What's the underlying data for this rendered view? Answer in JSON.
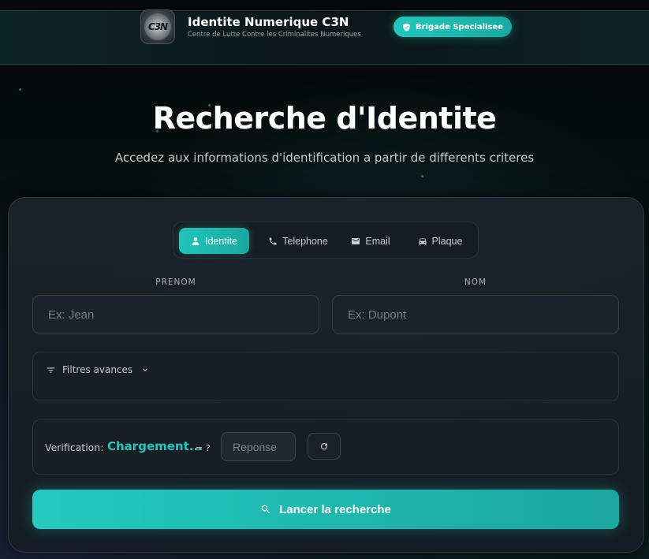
{
  "header": {
    "logo_text": "C3N",
    "title": "Identite Numerique C3N",
    "subtitle": "Centre de Lutte Contre les Criminalites Numeriques",
    "badge": "Brigade Specialisee"
  },
  "hero": {
    "title": "Recherche d'Identite",
    "subtitle": "Accedez aux informations d'identification a partir de differents criteres"
  },
  "tabs": [
    {
      "label": "Identite",
      "icon": "person-icon",
      "active": true
    },
    {
      "label": "Telephone",
      "icon": "phone-icon",
      "active": false
    },
    {
      "label": "Email",
      "icon": "email-icon",
      "active": false
    },
    {
      "label": "Plaque",
      "icon": "car-icon",
      "active": false
    }
  ],
  "form": {
    "prenom_label": "PRENOM",
    "prenom_placeholder": "Ex: Jean",
    "nom_label": "NOM",
    "nom_placeholder": "Ex: Dupont",
    "filters_label": "Filtres avances"
  },
  "verification": {
    "label": "Verification:",
    "value": "Chargement...",
    "equals": "= ?",
    "input_placeholder": "Reponse"
  },
  "submit_label": "Lancer la recherche",
  "colors": {
    "accent": "#22c7bd",
    "background": "#07100f",
    "card": "#1a232a"
  }
}
